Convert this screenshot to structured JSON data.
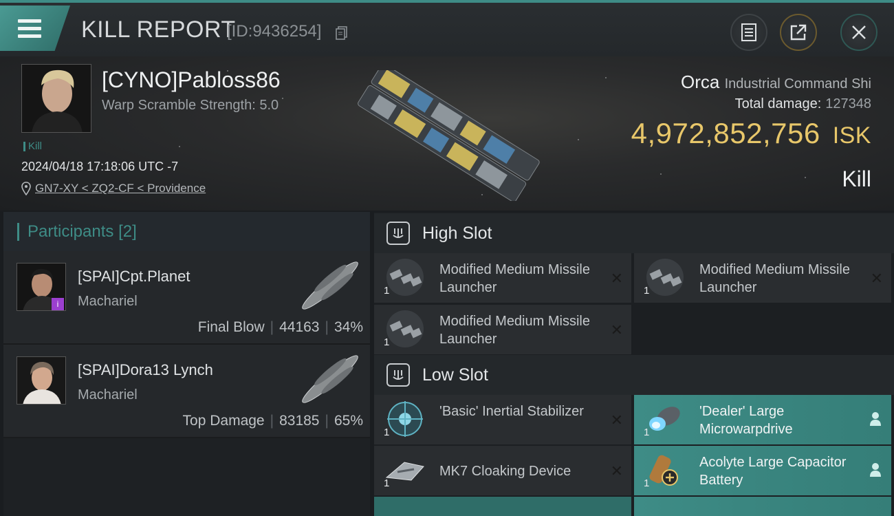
{
  "header": {
    "title": "KILL REPORT",
    "report_id": "[ID:9436254]"
  },
  "victim": {
    "name": "[CYNO]Pabloss86",
    "warp_scramble": "Warp Scramble Strength: 5.0",
    "kill_tag": "Kill",
    "datetime": "2024/04/18 17:18:06 UTC -7",
    "location": "GN7-XY < ZQ2-CF < Providence",
    "ship_name": "Orca",
    "ship_class": "Industrial Command Shi",
    "total_damage_label": "Total damage:",
    "total_damage_value": "127348",
    "isk_value": "4,972,852,756",
    "isk_unit": "ISK",
    "result": "Kill"
  },
  "participants": {
    "title": "Participants",
    "count": "[2]",
    "rows": [
      {
        "name": "[SPAI]Cpt.Planet",
        "ship": "Machariel",
        "label": "Final Blow",
        "damage": "44163",
        "pct": "34%"
      },
      {
        "name": "[SPAI]Dora13 Lynch",
        "ship": "Machariel",
        "label": "Top Damage",
        "damage": "83185",
        "pct": "65%"
      }
    ]
  },
  "slots": {
    "high_label": "High Slot",
    "low_label": "Low Slot",
    "high": [
      {
        "name": "Modified Medium Missile Launcher",
        "qty": "1",
        "status": "destroyed"
      },
      {
        "name": "Modified Medium Missile Launcher",
        "qty": "1",
        "status": "destroyed"
      },
      {
        "name": "Modified Medium Missile Launcher",
        "qty": "1",
        "status": "destroyed"
      }
    ],
    "low": [
      {
        "name": "'Basic' Inertial Stabilizer",
        "qty": "1",
        "status": "destroyed"
      },
      {
        "name": "'Dealer' Large Microwarpdrive",
        "qty": "1",
        "status": "dropped"
      },
      {
        "name": "MK7 Cloaking Device",
        "qty": "1",
        "status": "destroyed"
      },
      {
        "name": "Acolyte Large Capacitor Battery",
        "qty": "1",
        "status": "dropped"
      }
    ]
  },
  "icons": [
    "menu-icon",
    "copy-icon",
    "report-icon",
    "share-icon",
    "close-icon",
    "location-pin-icon",
    "slot-icon",
    "destroyed-x-icon",
    "person-icon"
  ],
  "colors": {
    "accent": "#3e8c86",
    "isk": "#e8c76a",
    "badge": "#9b3fd0"
  }
}
